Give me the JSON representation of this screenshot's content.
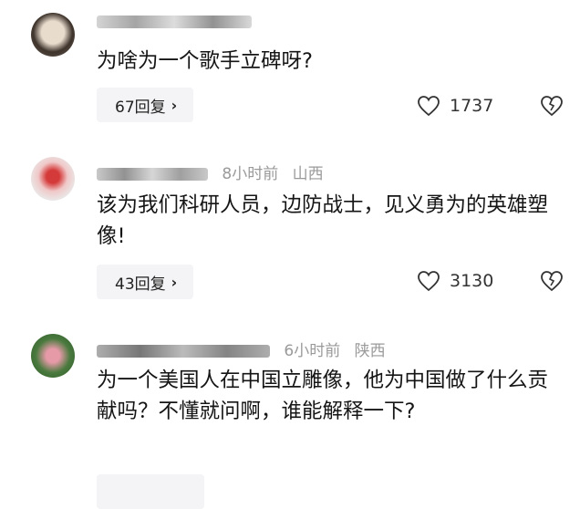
{
  "comments": [
    {
      "author": "",
      "time": "",
      "location": "",
      "text": "为啥为一个歌手立碑呀?",
      "reply_label": "67回复",
      "likes": "1737"
    },
    {
      "author": "",
      "time": "8小时前",
      "location": "山西",
      "text": "该为我们科研人员，边防战士，见义勇为的英雄塑像!",
      "reply_label": "43回复",
      "likes": "3130"
    },
    {
      "author": "",
      "time": "6小时前",
      "location": "陕西",
      "text": "为一个美国人在中国立雕像，他为中国做了什么贡献吗？不懂就问啊，谁能解释一下?",
      "reply_label": "",
      "likes": ""
    }
  ],
  "icons": {
    "reply_chevron": "chevron-right-icon",
    "like": "heart-icon",
    "dislike": "broken-heart-icon"
  },
  "colors": {
    "meta_text": "#9a9a9a",
    "reply_bg": "#f4f4f6"
  }
}
